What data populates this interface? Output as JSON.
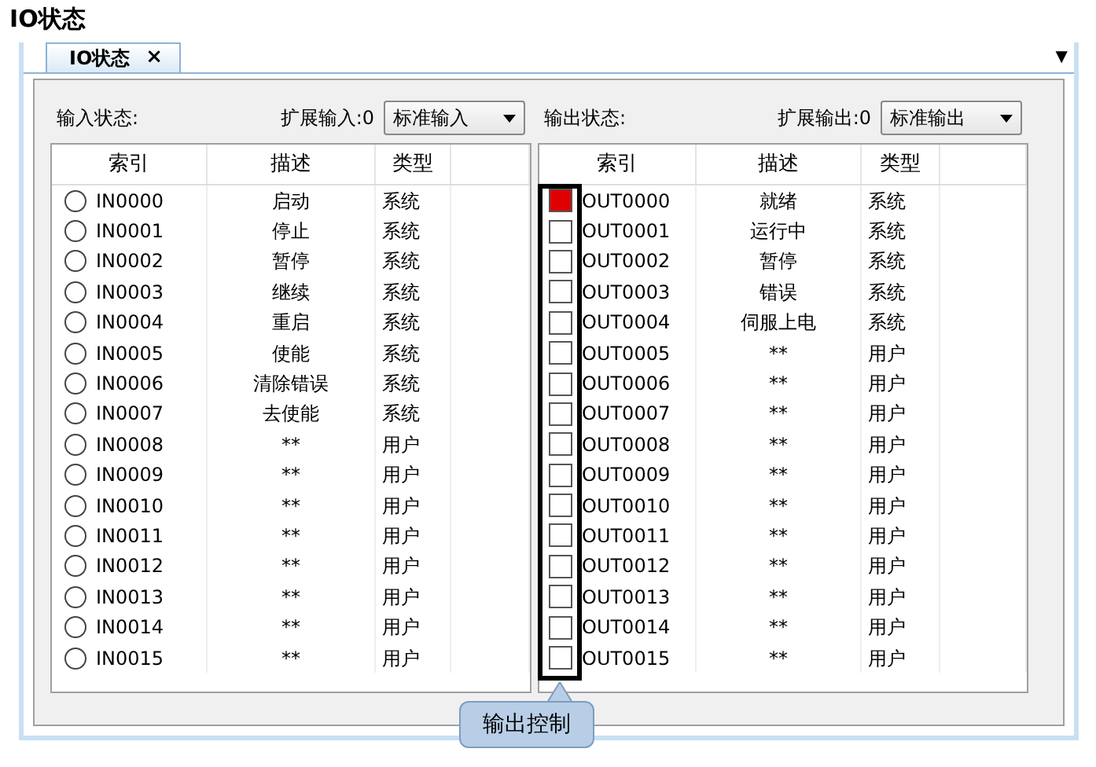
{
  "page_title": "IO状态",
  "tabs": [
    {
      "label": "IO状态",
      "close": "×",
      "selected": true
    }
  ],
  "tab_menu": "▼",
  "input_panel": {
    "title": "输入状态:",
    "expand_label": "扩展输入:0",
    "select_value": "标准输入",
    "columns": [
      "索引",
      "描述",
      "类型"
    ],
    "rows": [
      {
        "index": "IN0000",
        "desc": "启动",
        "type": "系统",
        "on": false
      },
      {
        "index": "IN0001",
        "desc": "停止",
        "type": "系统",
        "on": false
      },
      {
        "index": "IN0002",
        "desc": "暂停",
        "type": "系统",
        "on": false
      },
      {
        "index": "IN0003",
        "desc": "继续",
        "type": "系统",
        "on": false
      },
      {
        "index": "IN0004",
        "desc": "重启",
        "type": "系统",
        "on": false
      },
      {
        "index": "IN0005",
        "desc": "使能",
        "type": "系统",
        "on": false
      },
      {
        "index": "IN0006",
        "desc": "清除错误",
        "type": "系统",
        "on": false
      },
      {
        "index": "IN0007",
        "desc": "去使能",
        "type": "系统",
        "on": false
      },
      {
        "index": "IN0008",
        "desc": "**",
        "type": "用户",
        "on": false
      },
      {
        "index": "IN0009",
        "desc": "**",
        "type": "用户",
        "on": false
      },
      {
        "index": "IN0010",
        "desc": "**",
        "type": "用户",
        "on": false
      },
      {
        "index": "IN0011",
        "desc": "**",
        "type": "用户",
        "on": false
      },
      {
        "index": "IN0012",
        "desc": "**",
        "type": "用户",
        "on": false
      },
      {
        "index": "IN0013",
        "desc": "**",
        "type": "用户",
        "on": false
      },
      {
        "index": "IN0014",
        "desc": "**",
        "type": "用户",
        "on": false
      },
      {
        "index": "IN0015",
        "desc": "**",
        "type": "用户",
        "on": false
      }
    ]
  },
  "output_panel": {
    "title": "输出状态:",
    "expand_label": "扩展输出:0",
    "select_value": "标准输出",
    "columns": [
      "索引",
      "描述",
      "类型"
    ],
    "rows": [
      {
        "index": "OUT0000",
        "desc": "就绪",
        "type": "系统",
        "checked": true
      },
      {
        "index": "OUT0001",
        "desc": "运行中",
        "type": "系统",
        "checked": false
      },
      {
        "index": "OUT0002",
        "desc": "暂停",
        "type": "系统",
        "checked": false
      },
      {
        "index": "OUT0003",
        "desc": "错误",
        "type": "系统",
        "checked": false
      },
      {
        "index": "OUT0004",
        "desc": "伺服上电",
        "type": "系统",
        "checked": false
      },
      {
        "index": "OUT0005",
        "desc": "**",
        "type": "用户",
        "checked": false
      },
      {
        "index": "OUT0006",
        "desc": "**",
        "type": "用户",
        "checked": false
      },
      {
        "index": "OUT0007",
        "desc": "**",
        "type": "用户",
        "checked": false
      },
      {
        "index": "OUT0008",
        "desc": "**",
        "type": "用户",
        "checked": false
      },
      {
        "index": "OUT0009",
        "desc": "**",
        "type": "用户",
        "checked": false
      },
      {
        "index": "OUT0010",
        "desc": "**",
        "type": "用户",
        "checked": false
      },
      {
        "index": "OUT0011",
        "desc": "**",
        "type": "用户",
        "checked": false
      },
      {
        "index": "OUT0012",
        "desc": "**",
        "type": "用户",
        "checked": false
      },
      {
        "index": "OUT0013",
        "desc": "**",
        "type": "用户",
        "checked": false
      },
      {
        "index": "OUT0014",
        "desc": "**",
        "type": "用户",
        "checked": false
      },
      {
        "index": "OUT0015",
        "desc": "**",
        "type": "用户",
        "checked": false
      }
    ]
  },
  "callout": "输出控制"
}
